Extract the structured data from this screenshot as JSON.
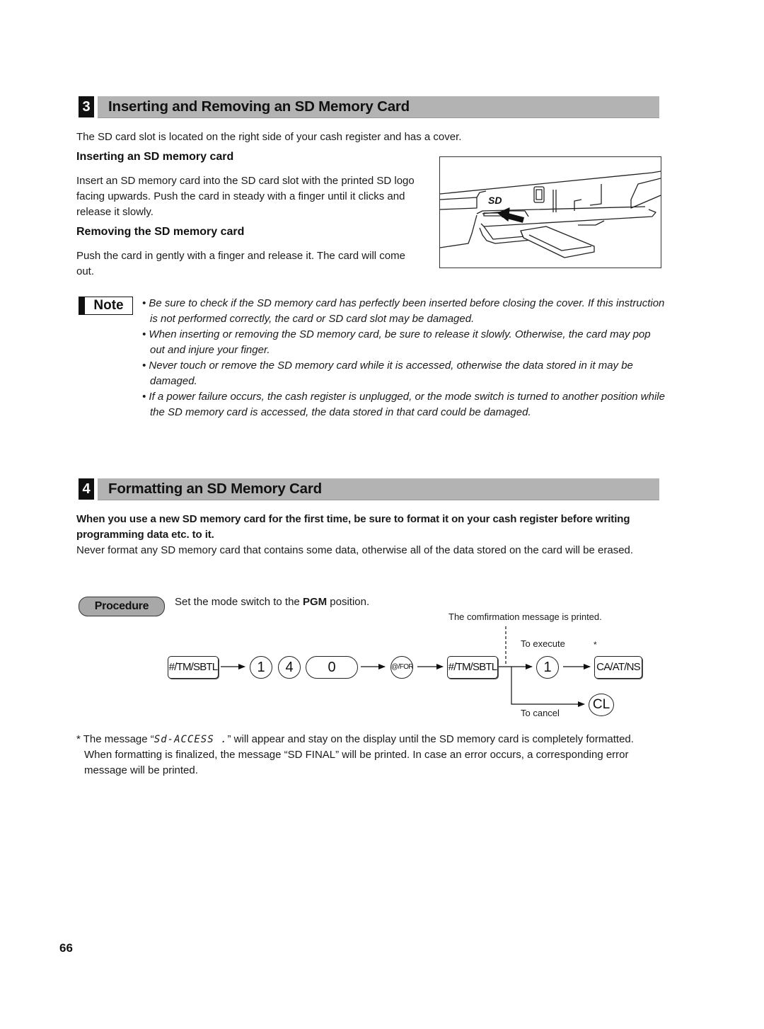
{
  "section3": {
    "number": "3",
    "title": "Inserting and Removing an SD Memory Card",
    "intro": "The SD card slot is located on the right side of your cash register and has a cover.",
    "inserting": {
      "heading": "Inserting an SD memory card",
      "text": "Insert an SD memory card into the SD card slot with the printed SD logo facing upwards. Push the card in steady with a finger until it clicks and release it slowly."
    },
    "removing": {
      "heading": "Removing the SD memory card",
      "text": "Push the card in gently with a finger and release it. The card will come out."
    },
    "figure": {
      "logo_text": "SD",
      "description": "SD card being inserted into slot on right side of cash register"
    },
    "note": {
      "label": "Note",
      "items": [
        "• Be sure to check if the SD memory card has perfectly been inserted before closing the cover. If this instruction is not performed correctly, the card or SD card slot may be damaged.",
        "• When inserting or removing the SD memory card, be sure to release it slowly. Otherwise, the card may pop out and injure your finger.",
        "• Never touch or remove the SD memory card while it is accessed, otherwise the data stored in it may be damaged.",
        "• If a power failure occurs, the cash register is unplugged, or the mode switch is turned to another position while the SD memory card is accessed, the data stored in that card could be damaged."
      ]
    }
  },
  "section4": {
    "number": "4",
    "title": "Formatting an SD Memory Card",
    "bold_intro": "When you use a new SD memory card for the first time, be sure to format it on your cash register before writing programming data etc. to it.",
    "warning": "Never format any SD memory card that contains some data, otherwise all of the data stored on the card will be erased.",
    "procedure": {
      "label": "Procedure",
      "step_prefix": "Set the mode switch to the ",
      "step_bold": "PGM",
      "step_suffix": " position.",
      "confirmation": "The comfirmation message is printed.",
      "to_execute": "To execute",
      "to_cancel": "To cancel",
      "asterisk": "*",
      "keys": {
        "tm_sbtl_1": "#/TM/SBTL",
        "digit_1": "1",
        "digit_4": "4",
        "digit_0": "0",
        "at_for": "@/FOR",
        "tm_sbtl_2": "#/TM/SBTL",
        "execute_1": "1",
        "ca_at_ns": "CA/AT/NS",
        "cl": "CL"
      }
    },
    "footnote": {
      "prefix": "* The message “",
      "display": "Sd-ACCESS .",
      "suffix": "” will appear and stay on the display until the SD memory card is completely formatted. When formatting is finalized, the message “SD FINAL” will be printed. In case an error occurs, a corresponding error message will be printed."
    }
  },
  "page_number": "66"
}
